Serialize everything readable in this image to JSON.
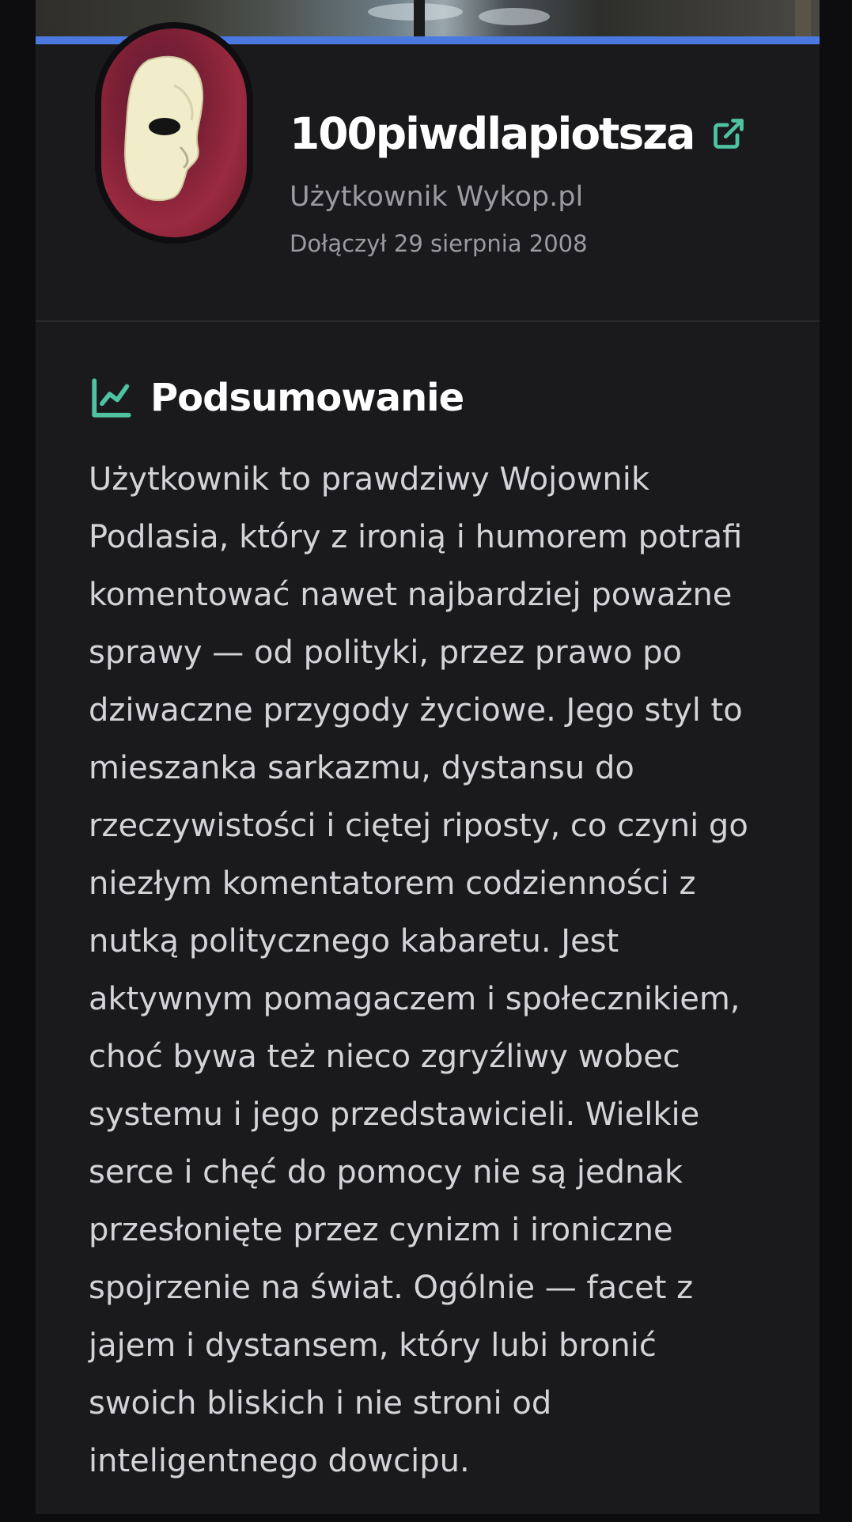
{
  "profile": {
    "username": "100piwdlapiotsza",
    "role": "Użytkownik Wykop.pl",
    "joined": "Dołączył 29 sierpnia 2008"
  },
  "summary": {
    "title": "Podsumowanie",
    "text": "Użytkownik to prawdziwy Wojownik Podlasia, który z ironią i humorem potrafi komentować nawet najbardziej poważne sprawy — od polityki, przez prawo po dziwaczne przygody życiowe. Jego styl to mieszanka sarkazmu, dystansu do rzeczywistości i ciętej riposty, co czyni go niezłym komentatorem codzienności z nutką politycznego kabaretu. Jest aktywnym pomagaczem i społecznikiem, choć bywa też nieco zgryźliwy wobec systemu i jego przedstawicieli. Wielkie serce i chęć do pomocy nie są jednak przesłonięte przez cynizm i ironiczne spojrzenie na świat. Ogólnie — facet z jajem i dystansem, który lubi bronić swoich bliskich i nie stroni od inteligentnego dowcipu."
  },
  "colors": {
    "accent_bar": "#4a79e0",
    "icon_teal": "#4fc3a1",
    "card_background": "#1a1a1c",
    "page_background": "#0d0d0f"
  },
  "icons": {
    "external_link": "external-link-icon",
    "summary": "trend-chart-icon"
  }
}
